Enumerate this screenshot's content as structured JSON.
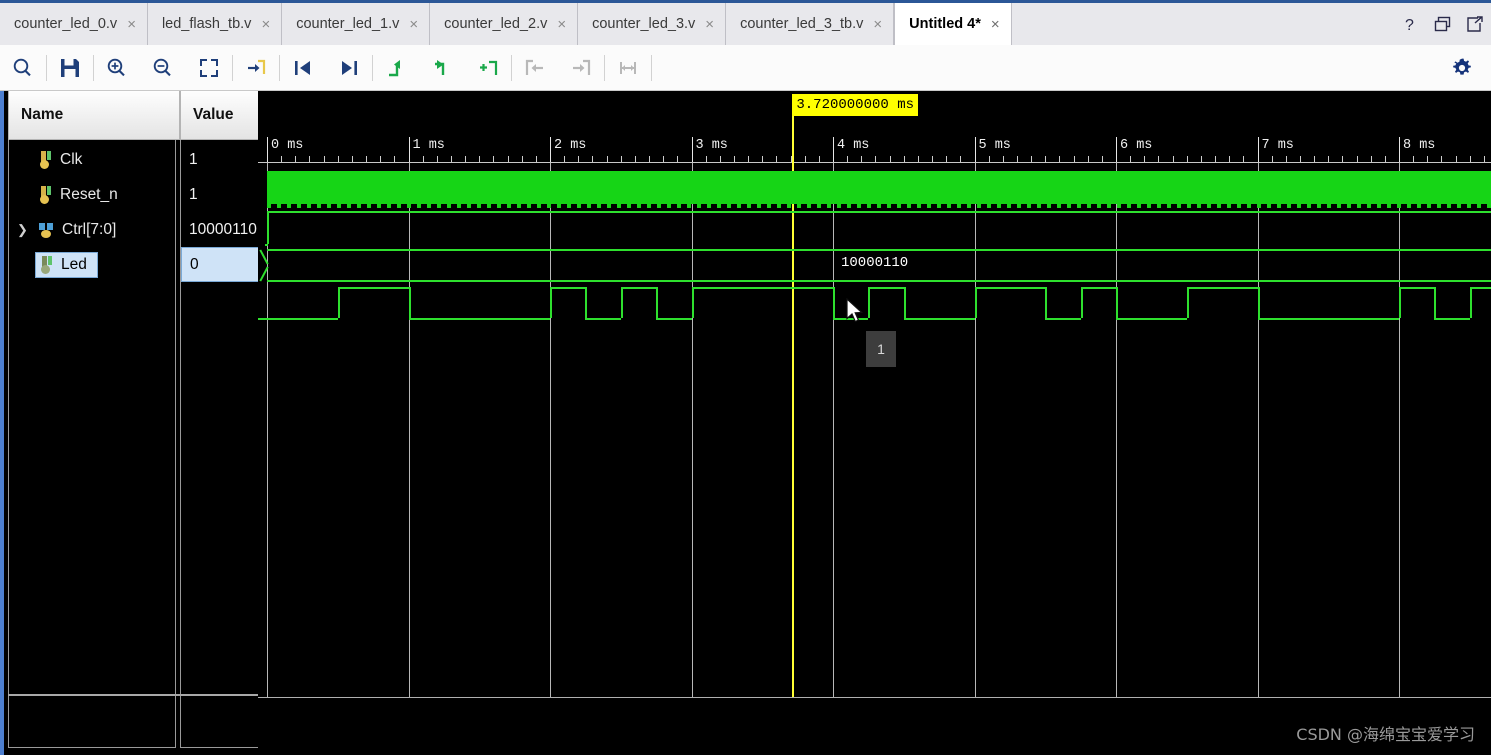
{
  "window": {
    "help_icon": "question-mark-icon",
    "restore_icon": "restore-window-icon",
    "float_icon": "float-window-icon"
  },
  "tabs": [
    {
      "label": "counter_led_0.v",
      "close": "×",
      "active": false
    },
    {
      "label": "led_flash_tb.v",
      "close": "×",
      "active": false
    },
    {
      "label": "counter_led_1.v",
      "close": "×",
      "active": false
    },
    {
      "label": "counter_led_2.v",
      "close": "×",
      "active": false
    },
    {
      "label": "counter_led_3.v",
      "close": "×",
      "active": false
    },
    {
      "label": "counter_led_3_tb.v",
      "close": "×",
      "active": false
    },
    {
      "label": "Untitled 4*",
      "close": "×",
      "active": true
    }
  ],
  "toolbar": {
    "buttons": [
      {
        "name": "search-icon",
        "enabled": true
      },
      {
        "name": "save-icon",
        "enabled": true
      },
      {
        "name": "zoom-in-icon",
        "enabled": true
      },
      {
        "name": "zoom-out-icon",
        "enabled": true
      },
      {
        "name": "zoom-fit-icon",
        "enabled": true
      },
      {
        "name": "add-marker-icon",
        "enabled": true
      },
      {
        "name": "previous-transition-icon",
        "enabled": true
      },
      {
        "name": "next-transition-icon",
        "enabled": true
      },
      {
        "name": "previous-marker-icon",
        "enabled": true
      },
      {
        "name": "next-marker-icon",
        "enabled": true
      },
      {
        "name": "add-divider-icon",
        "enabled": true
      },
      {
        "name": "snap-left-icon",
        "enabled": false
      },
      {
        "name": "snap-right-icon",
        "enabled": false
      },
      {
        "name": "measure-icon",
        "enabled": false
      }
    ],
    "settings_icon": "gear-icon"
  },
  "panel": {
    "header_name": "Name",
    "header_value": "Value",
    "signals": [
      {
        "name": "Clk",
        "value": "1",
        "icon": "clock-signal-icon",
        "type": "wire",
        "expandable": false,
        "selected": false
      },
      {
        "name": "Reset_n",
        "value": "1",
        "icon": "wire-signal-icon",
        "type": "wire",
        "expandable": false,
        "selected": false
      },
      {
        "name": "Ctrl[7:0]",
        "value": "10000110",
        "icon": "bus-signal-icon",
        "type": "bus",
        "expandable": true,
        "selected": false
      },
      {
        "name": "Led",
        "value": "0",
        "icon": "led-signal-icon",
        "type": "wire",
        "expandable": false,
        "selected": true
      }
    ]
  },
  "wave": {
    "marker_label": "3.720000000 ms",
    "marker_time_ms": 3.72,
    "bus_value_label": "10000110",
    "tooltip_value": "1",
    "time_axis": {
      "unit": "ms",
      "major_ticks": [
        "0 ms",
        "1 ms",
        "2 ms",
        "3 ms",
        "4 ms",
        "5 ms",
        "6 ms",
        "7 ms",
        "8 ms"
      ],
      "start_ms": 0,
      "end_ms": 8.65,
      "minor_per_major": 10
    },
    "signal_colors": {
      "high_low": "#2ee02e",
      "clock_block": "#16d516",
      "cursor": "#ffff33",
      "grid": "#b8b8b8",
      "background": "#000000"
    },
    "led_transitions_ms": [
      0.0,
      0.5,
      1.0,
      2.0,
      2.25,
      2.5,
      2.75,
      3.0,
      4.0,
      4.25,
      4.5,
      5.0,
      5.5,
      5.75,
      6.0,
      6.5,
      7.0,
      8.0,
      8.25,
      8.5
    ],
    "led_initial_level": 0,
    "reset_rise_ms": 0.02
  },
  "watermark": "CSDN @海绵宝宝爱学习"
}
